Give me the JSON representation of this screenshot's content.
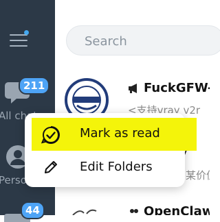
{
  "sidebar": {
    "menu_icon": "hamburger-menu-icon",
    "notification_dot_color": "#44a8f0",
    "folders": [
      {
        "label": "All chats",
        "badge": "211",
        "icon": "chats-icon"
      },
      {
        "label": "Personal",
        "icon": "person-icon"
      },
      {
        "badge": "44",
        "icon": "folder-icon"
      }
    ]
  },
  "search": {
    "placeholder": "Search"
  },
  "chats": [
    {
      "title": "FuckGFW-N",
      "preview": "<支持vray v2r",
      "icon": "megaphone-icon"
    },
    {
      "title": "y",
      "preview": "某价值"
    },
    {
      "title": "OpenClaw",
      "icon": "group-icon"
    }
  ],
  "context_menu": {
    "items": [
      {
        "label": "Mark as read",
        "icon": "check-circle-icon",
        "highlight_color": "#f4f40a"
      },
      {
        "label": "Edit Folders",
        "icon": "pencil-icon"
      }
    ]
  },
  "colors": {
    "sidebar": "#2c3947",
    "badge": "#4ea4f6",
    "accent": "#44a8f0"
  }
}
